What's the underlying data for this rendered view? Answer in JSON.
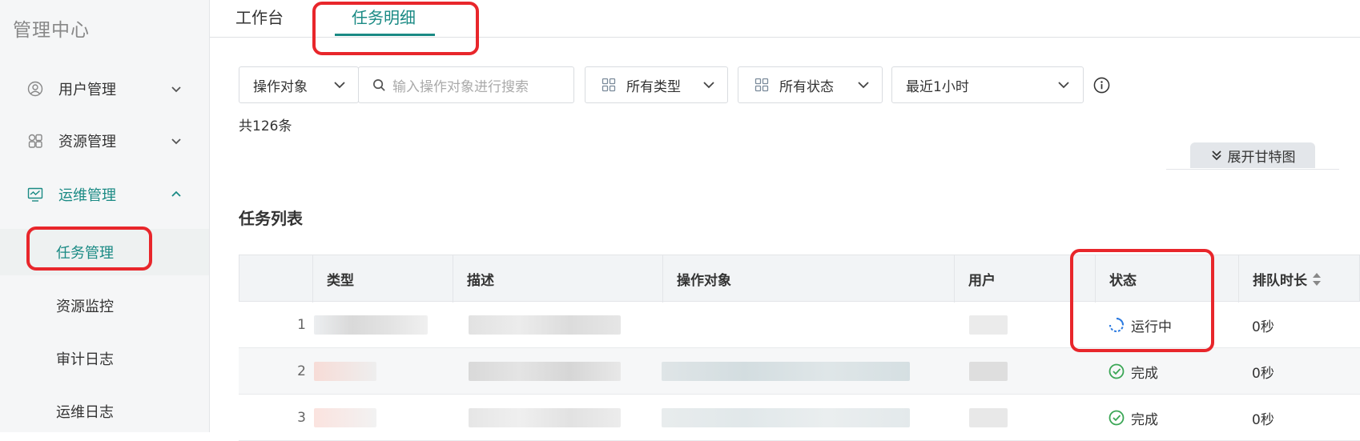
{
  "sidebar": {
    "title": "管理中心",
    "items": [
      {
        "label": "用户管理",
        "icon": "user-icon"
      },
      {
        "label": "资源管理",
        "icon": "grid-icon"
      },
      {
        "label": "运维管理",
        "icon": "monitor-chart-icon"
      }
    ],
    "sub_items": [
      {
        "label": "任务管理"
      },
      {
        "label": "资源监控"
      },
      {
        "label": "审计日志"
      },
      {
        "label": "运维日志"
      }
    ]
  },
  "tabs": [
    {
      "label": "工作台"
    },
    {
      "label": "任务明细"
    }
  ],
  "filters": {
    "target_select": "操作对象",
    "search_placeholder": "输入操作对象进行搜索",
    "type_select": "所有类型",
    "status_select": "所有状态",
    "time_select": "最近1小时"
  },
  "count_text": "共126条",
  "gantt_button": "展开甘特图",
  "section_title": "任务列表",
  "table": {
    "headers": [
      "类型",
      "描述",
      "操作对象",
      "用户",
      "状态",
      "排队时长"
    ],
    "rows": [
      {
        "index": "1",
        "status": "运行中",
        "queue": "0秒"
      },
      {
        "index": "2",
        "status": "完成",
        "queue": "0秒"
      },
      {
        "index": "3",
        "status": "完成",
        "queue": "0秒"
      }
    ]
  },
  "colors": {
    "accent": "#1a8a84",
    "running": "#2d7be0",
    "done": "#3aa655",
    "annotation": "#e8262b"
  }
}
